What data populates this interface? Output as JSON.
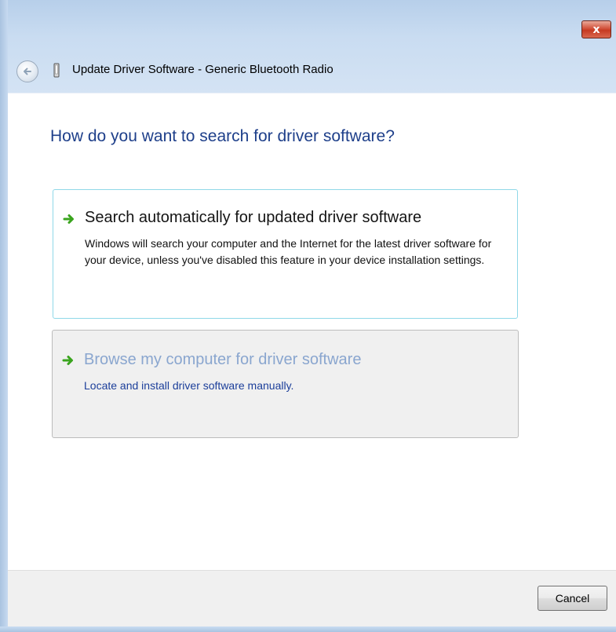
{
  "window": {
    "title": "Update Driver Software - Generic Bluetooth Radio",
    "close_label": "x"
  },
  "icons": {
    "back": "back-arrow-icon",
    "device": "device-icon",
    "option_arrow": "green-arrow-icon",
    "close": "close-icon"
  },
  "content": {
    "question": "How do you want to search for driver software?",
    "options": [
      {
        "title": "Search automatically for updated driver software",
        "description": "Windows will search your computer and the Internet for the latest driver software for your device, unless you've disabled this feature in your device installation settings."
      },
      {
        "title": "Browse my computer for driver software",
        "description": "Locate and install driver software manually."
      }
    ]
  },
  "footer": {
    "cancel_label": "Cancel"
  },
  "colors": {
    "heading": "#1e3f8a",
    "selected_border": "#8fd8e8",
    "hover_background": "#f0f0f0",
    "arrow_green": "#3aa41e",
    "close_red": "#c63a22"
  }
}
